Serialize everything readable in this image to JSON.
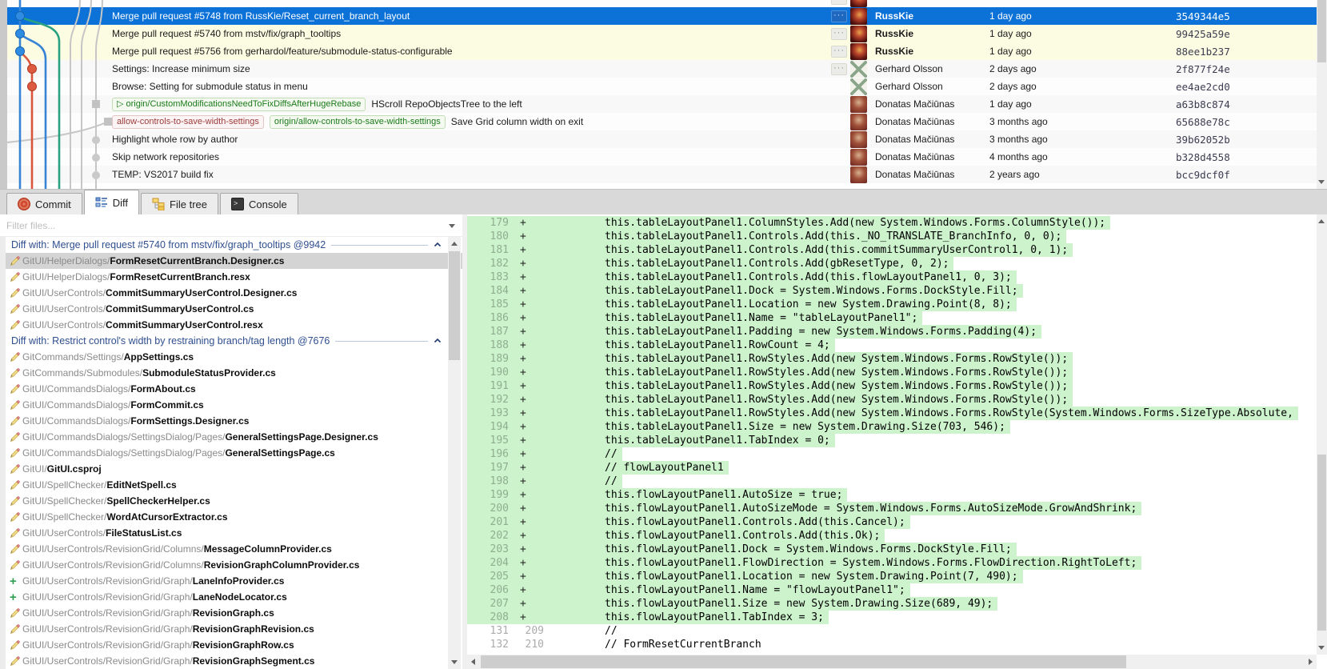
{
  "colors": {
    "selection_blue": "#0c72d8",
    "row_highlight_yellow": "#fcfce2",
    "diff_added_bg": "#cdf3cd",
    "remote_badge_green": "#1a7a1a",
    "local_badge_red": "#9c3a3a",
    "lane_blue": "#3584d6",
    "lane_red": "#d9563d",
    "lane_green": "#2aa181",
    "lane_gray": "#c6c6c6"
  },
  "commit_grid": {
    "rows": [
      {
        "partial": true,
        "message": "",
        "badges": [],
        "author": "",
        "date": "",
        "hash": "",
        "avatar": "russkie",
        "dots": true,
        "bg": "white"
      },
      {
        "selected": true,
        "message": "Merge pull request #5748 from RussKie/Reset_current_branch_layout",
        "badges": [],
        "author": "RussKie",
        "author_bold": true,
        "date": "1 day ago",
        "hash": "3549344e5",
        "avatar": "russkie",
        "dots": true,
        "bg": "selected"
      },
      {
        "message": "Merge pull request #5740 from mstv/fix/graph_tooltips",
        "badges": [],
        "author": "RussKie",
        "author_bold": true,
        "date": "1 day ago",
        "hash": "99425a59e",
        "avatar": "russkie",
        "dots": true,
        "bg": "yellow"
      },
      {
        "message": "Merge pull request #5756 from gerhardol/feature/submodule-status-configurable",
        "badges": [],
        "author": "RussKie",
        "author_bold": true,
        "date": "1 day ago",
        "hash": "88ee1b237",
        "avatar": "russkie",
        "dots": true,
        "bg": "yellow"
      },
      {
        "message": "Settings: Increase minimum size",
        "badges": [],
        "author": "Gerhard Olsson",
        "date": "2 days ago",
        "hash": "2f877f24e",
        "avatar": "gerhard",
        "dots": true,
        "bg": "alt"
      },
      {
        "message": "Browse: Setting for submodule status in menu",
        "badges": [],
        "author": "Gerhard Olsson",
        "date": "2 days ago",
        "hash": "ee4ae2cd0",
        "avatar": "gerhard",
        "bg": "white"
      },
      {
        "message": "HScroll RepoObjectsTree to the left",
        "badges": [
          {
            "text": "origin/CustomModificationsNeedToFixDiffsAfterHugeRebase",
            "kind": "remote",
            "arrow": true
          }
        ],
        "author": "Donatas Mačiūnas",
        "date": "1 day ago",
        "hash": "a63b8c874",
        "avatar": "donatas",
        "bg": "alt"
      },
      {
        "message": "Save Grid column width on exit",
        "badges": [
          {
            "text": "allow-controls-to-save-width-settings",
            "kind": "local"
          },
          {
            "text": "origin/allow-controls-to-save-width-settings",
            "kind": "remote"
          }
        ],
        "author": "Donatas Mačiūnas",
        "date": "3 months ago",
        "hash": "65688e78c",
        "avatar": "donatas",
        "bg": "white"
      },
      {
        "message": "Highlight whole row by author",
        "badges": [],
        "author": "Donatas Mačiūnas",
        "date": "3 months ago",
        "hash": "39b62052b",
        "avatar": "donatas",
        "bg": "alt"
      },
      {
        "message": "Skip network repositories",
        "badges": [],
        "author": "Donatas Mačiūnas",
        "date": "4 months ago",
        "hash": "b328d4558",
        "avatar": "donatas",
        "bg": "white"
      },
      {
        "message": "TEMP: VS2017 build fix",
        "badges": [],
        "author": "Donatas Mačiūnas",
        "date": "2 years ago",
        "hash": "bcc9dcf0f",
        "avatar": "donatas",
        "bg": "alt"
      }
    ]
  },
  "tabs": [
    {
      "label": "Commit",
      "icon": "commit-icon"
    },
    {
      "label": "Diff",
      "icon": "diff-icon",
      "active": true
    },
    {
      "label": "File tree",
      "icon": "file-tree-icon"
    },
    {
      "label": "Console",
      "icon": "console-icon"
    }
  ],
  "file_panel": {
    "filter_placeholder": "Filter files...",
    "groups": [
      {
        "title": "Diff with: Merge pull request #5740 from mstv/fix/graph_tooltips @9942",
        "files": [
          {
            "path": "GitUI/HelperDialogs/",
            "name": "FormResetCurrentBranch.Designer.cs",
            "icon": "modified",
            "selected": true
          },
          {
            "path": "GitUI/HelperDialogs/",
            "name": "FormResetCurrentBranch.resx",
            "icon": "modified"
          },
          {
            "path": "GitUI/UserControls/",
            "name": "CommitSummaryUserControl.Designer.cs",
            "icon": "modified"
          },
          {
            "path": "GitUI/UserControls/",
            "name": "CommitSummaryUserControl.cs",
            "icon": "modified"
          },
          {
            "path": "GitUI/UserControls/",
            "name": "CommitSummaryUserControl.resx",
            "icon": "modified"
          }
        ]
      },
      {
        "title": "Diff with: Restrict control's width by restraining branch/tag length @7676",
        "files": [
          {
            "path": "GitCommands/Settings/",
            "name": "AppSettings.cs",
            "icon": "modified"
          },
          {
            "path": "GitCommands/Submodules/",
            "name": "SubmoduleStatusProvider.cs",
            "icon": "modified"
          },
          {
            "path": "GitUI/CommandsDialogs/",
            "name": "FormAbout.cs",
            "icon": "modified"
          },
          {
            "path": "GitUI/CommandsDialogs/",
            "name": "FormCommit.cs",
            "icon": "modified"
          },
          {
            "path": "GitUI/CommandsDialogs/",
            "name": "FormSettings.Designer.cs",
            "icon": "modified"
          },
          {
            "path": "GitUI/CommandsDialogs/SettingsDialog/Pages/",
            "name": "GeneralSettingsPage.Designer.cs",
            "icon": "modified"
          },
          {
            "path": "GitUI/CommandsDialogs/SettingsDialog/Pages/",
            "name": "GeneralSettingsPage.cs",
            "icon": "modified"
          },
          {
            "path": "GitUI/",
            "name": "GitUI.csproj",
            "icon": "modified"
          },
          {
            "path": "GitUI/SpellChecker/",
            "name": "EditNetSpell.cs",
            "icon": "modified"
          },
          {
            "path": "GitUI/SpellChecker/",
            "name": "SpellCheckerHelper.cs",
            "icon": "modified"
          },
          {
            "path": "GitUI/SpellChecker/",
            "name": "WordAtCursorExtractor.cs",
            "icon": "modified"
          },
          {
            "path": "GitUI/UserControls/",
            "name": "FileStatusList.cs",
            "icon": "modified"
          },
          {
            "path": "GitUI/UserControls/RevisionGrid/Columns/",
            "name": "MessageColumnProvider.cs",
            "icon": "modified"
          },
          {
            "path": "GitUI/UserControls/RevisionGrid/Columns/",
            "name": "RevisionGraphColumnProvider.cs",
            "icon": "modified"
          },
          {
            "path": "GitUI/UserControls/RevisionGrid/Graph/",
            "name": "LaneInfoProvider.cs",
            "icon": "added"
          },
          {
            "path": "GitUI/UserControls/RevisionGrid/Graph/",
            "name": "LaneNodeLocator.cs",
            "icon": "added"
          },
          {
            "path": "GitUI/UserControls/RevisionGrid/Graph/",
            "name": "RevisionGraph.cs",
            "icon": "modified"
          },
          {
            "path": "GitUI/UserControls/RevisionGrid/Graph/",
            "name": "RevisionGraphRevision.cs",
            "icon": "modified"
          },
          {
            "path": "GitUI/UserControls/RevisionGrid/Graph/",
            "name": "RevisionGraphRow.cs",
            "icon": "modified"
          },
          {
            "path": "GitUI/UserControls/RevisionGrid/Graph/",
            "name": "RevisionGraphSegment.cs",
            "icon": "modified"
          }
        ]
      }
    ]
  },
  "diff_panel": {
    "lines": [
      {
        "old": "",
        "num": "179",
        "mark": "+",
        "added": true,
        "code": "this.tableLayoutPanel1.ColumnStyles.Add(new System.Windows.Forms.ColumnStyle());"
      },
      {
        "old": "",
        "num": "180",
        "mark": "+",
        "added": true,
        "code": "this.tableLayoutPanel1.Controls.Add(this._NO_TRANSLATE_BranchInfo, 0, 0);"
      },
      {
        "old": "",
        "num": "181",
        "mark": "+",
        "added": true,
        "code": "this.tableLayoutPanel1.Controls.Add(this.commitSummaryUserControl1, 0, 1);"
      },
      {
        "old": "",
        "num": "182",
        "mark": "+",
        "added": true,
        "code": "this.tableLayoutPanel1.Controls.Add(gbResetType, 0, 2);"
      },
      {
        "old": "",
        "num": "183",
        "mark": "+",
        "added": true,
        "code": "this.tableLayoutPanel1.Controls.Add(this.flowLayoutPanel1, 0, 3);"
      },
      {
        "old": "",
        "num": "184",
        "mark": "+",
        "added": true,
        "code": "this.tableLayoutPanel1.Dock = System.Windows.Forms.DockStyle.Fill;"
      },
      {
        "old": "",
        "num": "185",
        "mark": "+",
        "added": true,
        "code": "this.tableLayoutPanel1.Location = new System.Drawing.Point(8, 8);"
      },
      {
        "old": "",
        "num": "186",
        "mark": "+",
        "added": true,
        "code": "this.tableLayoutPanel1.Name = \"tableLayoutPanel1\";"
      },
      {
        "old": "",
        "num": "187",
        "mark": "+",
        "added": true,
        "code": "this.tableLayoutPanel1.Padding = new System.Windows.Forms.Padding(4);"
      },
      {
        "old": "",
        "num": "188",
        "mark": "+",
        "added": true,
        "code": "this.tableLayoutPanel1.RowCount = 4;"
      },
      {
        "old": "",
        "num": "189",
        "mark": "+",
        "added": true,
        "code": "this.tableLayoutPanel1.RowStyles.Add(new System.Windows.Forms.RowStyle());"
      },
      {
        "old": "",
        "num": "190",
        "mark": "+",
        "added": true,
        "code": "this.tableLayoutPanel1.RowStyles.Add(new System.Windows.Forms.RowStyle());"
      },
      {
        "old": "",
        "num": "191",
        "mark": "+",
        "added": true,
        "code": "this.tableLayoutPanel1.RowStyles.Add(new System.Windows.Forms.RowStyle());"
      },
      {
        "old": "",
        "num": "192",
        "mark": "+",
        "added": true,
        "code": "this.tableLayoutPanel1.RowStyles.Add(new System.Windows.Forms.RowStyle());"
      },
      {
        "old": "",
        "num": "193",
        "mark": "+",
        "added": true,
        "code": "this.tableLayoutPanel1.RowStyles.Add(new System.Windows.Forms.RowStyle(System.Windows.Forms.SizeType.Absolute,"
      },
      {
        "old": "",
        "num": "194",
        "mark": "+",
        "added": true,
        "code": "this.tableLayoutPanel1.Size = new System.Drawing.Size(703, 546);"
      },
      {
        "old": "",
        "num": "195",
        "mark": "+",
        "added": true,
        "code": "this.tableLayoutPanel1.TabIndex = 0;"
      },
      {
        "old": "",
        "num": "196",
        "mark": "+",
        "added": true,
        "code": "//"
      },
      {
        "old": "",
        "num": "197",
        "mark": "+",
        "added": true,
        "code": "// flowLayoutPanel1"
      },
      {
        "old": "",
        "num": "198",
        "mark": "+",
        "added": true,
        "code": "//"
      },
      {
        "old": "",
        "num": "199",
        "mark": "+",
        "added": true,
        "code": "this.flowLayoutPanel1.AutoSize = true;"
      },
      {
        "old": "",
        "num": "200",
        "mark": "+",
        "added": true,
        "code": "this.flowLayoutPanel1.AutoSizeMode = System.Windows.Forms.AutoSizeMode.GrowAndShrink;"
      },
      {
        "old": "",
        "num": "201",
        "mark": "+",
        "added": true,
        "code": "this.flowLayoutPanel1.Controls.Add(this.Cancel);"
      },
      {
        "old": "",
        "num": "202",
        "mark": "+",
        "added": true,
        "code": "this.flowLayoutPanel1.Controls.Add(this.Ok);"
      },
      {
        "old": "",
        "num": "203",
        "mark": "+",
        "added": true,
        "code": "this.flowLayoutPanel1.Dock = System.Windows.Forms.DockStyle.Fill;"
      },
      {
        "old": "",
        "num": "204",
        "mark": "+",
        "added": true,
        "code": "this.flowLayoutPanel1.FlowDirection = System.Windows.Forms.FlowDirection.RightToLeft;"
      },
      {
        "old": "",
        "num": "205",
        "mark": "+",
        "added": true,
        "code": "this.flowLayoutPanel1.Location = new System.Drawing.Point(7, 490);"
      },
      {
        "old": "",
        "num": "206",
        "mark": "+",
        "added": true,
        "code": "this.flowLayoutPanel1.Name = \"flowLayoutPanel1\";"
      },
      {
        "old": "",
        "num": "207",
        "mark": "+",
        "added": true,
        "code": "this.flowLayoutPanel1.Size = new System.Drawing.Size(689, 49);"
      },
      {
        "old": "",
        "num": "208",
        "mark": "+",
        "added": true,
        "code": "this.flowLayoutPanel1.TabIndex = 3;"
      },
      {
        "old": "131",
        "num": "209",
        "mark": "",
        "added": false,
        "code": "//"
      },
      {
        "old": "132",
        "num": "210",
        "mark": "",
        "added": false,
        "code": "// FormResetCurrentBranch"
      }
    ]
  }
}
